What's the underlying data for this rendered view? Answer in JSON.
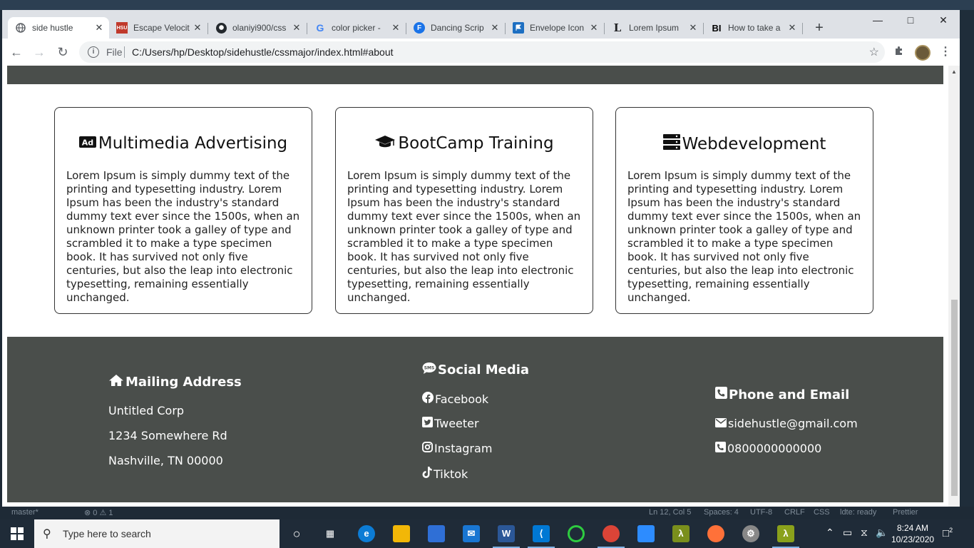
{
  "browser": {
    "tabs": [
      {
        "title": "side hustle",
        "favicon": "globe-icon",
        "active": true
      },
      {
        "title": "Escape Velocit",
        "favicon": "hsu-icon"
      },
      {
        "title": "olaniyi900/css",
        "favicon": "github-icon"
      },
      {
        "title": "color picker -",
        "favicon": "google-icon"
      },
      {
        "title": "Dancing Scrip",
        "favicon": "fonts-icon"
      },
      {
        "title": "Envelope Icon",
        "favicon": "flag-icon"
      },
      {
        "title": "Lorem Ipsum",
        "favicon": "lipsum-icon"
      },
      {
        "title": "How to take a",
        "favicon": "bi-icon"
      }
    ],
    "tab_close_glyph": "✕",
    "new_tab_glyph": "+",
    "address": {
      "scheme": "File",
      "url": "C:/Users/hp/Desktop/sidehustle/cssmajor/index.html#about"
    }
  },
  "cards": [
    {
      "icon": "ad-icon",
      "title": "Multimedia Advertising",
      "text": "Lorem Ipsum is simply dummy text of the printing and typesetting industry. Lorem Ipsum has been the industry's standard dummy text ever since the 1500s, when an unknown printer took a galley of type and scrambled it to make a type specimen book. It has survived not only five centuries, but also the leap into electronic typesetting, remaining essentially unchanged."
    },
    {
      "icon": "graduation-cap-icon",
      "title": "BootCamp Training",
      "text": "Lorem Ipsum is simply dummy text of the printing and typesetting industry. Lorem Ipsum has been the industry's standard dummy text ever since the 1500s, when an unknown printer took a galley of type and scrambled it to make a type specimen book. It has survived not only five centuries, but also the leap into electronic typesetting, remaining essentially unchanged."
    },
    {
      "icon": "server-icon",
      "title": "Webdevelopment",
      "text": "Lorem Ipsum is simply dummy text of the printing and typesetting industry. Lorem Ipsum has been the industry's standard dummy text ever since the 1500s, when an unknown printer took a galley of type and scrambled it to make a type specimen book. It has survived not only five centuries, but also the leap into electronic typesetting, remaining essentially unchanged."
    }
  ],
  "footer": {
    "mailing": {
      "icon": "home-icon",
      "heading": "Mailing Address",
      "lines": [
        "Untitled Corp",
        "1234 Somewhere Rd",
        "Nashville, TN 00000"
      ]
    },
    "social": {
      "icon": "sms-icon",
      "heading": "Social Media",
      "links": [
        {
          "icon": "facebook-icon",
          "label": "Facebook"
        },
        {
          "icon": "twitter-icon",
          "label": "Tweeter"
        },
        {
          "icon": "instagram-icon",
          "label": "Instagram"
        },
        {
          "icon": "tiktok-icon",
          "label": "Tiktok"
        }
      ]
    },
    "contact": {
      "icon": "phone-icon",
      "heading": "Phone and Email",
      "email": {
        "icon": "envelope-icon",
        "label": "sidehustle@gmail.com"
      },
      "phone": {
        "icon": "phone-icon",
        "label": "0800000000000"
      }
    }
  },
  "editor_status": {
    "branch": "master*",
    "problems": "⊗ 0 ⚠ 1",
    "position": "Ln 12, Col 5",
    "spaces": "Spaces: 4",
    "encoding": "UTF-8",
    "eol": "CRLF",
    "language": "CSS",
    "linter": "ldte: ready",
    "formatter": "Prettier"
  },
  "taskbar": {
    "search_placeholder": "Type here to search",
    "time": "8:24 AM",
    "date": "10/23/2020",
    "notifications": "2"
  },
  "colors": {
    "footer_bg": "#4a4e4b",
    "card_border": "#333333",
    "taskbar_bg": "#1f2b38"
  }
}
